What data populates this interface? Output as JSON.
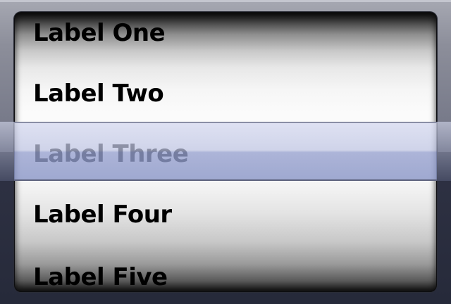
{
  "picker": {
    "items": [
      {
        "label": "Label One"
      },
      {
        "label": "Label Two"
      },
      {
        "label": "Label Three"
      },
      {
        "label": "Label Four"
      },
      {
        "label": "Label Five"
      }
    ],
    "selected_label": "Label Three"
  }
}
